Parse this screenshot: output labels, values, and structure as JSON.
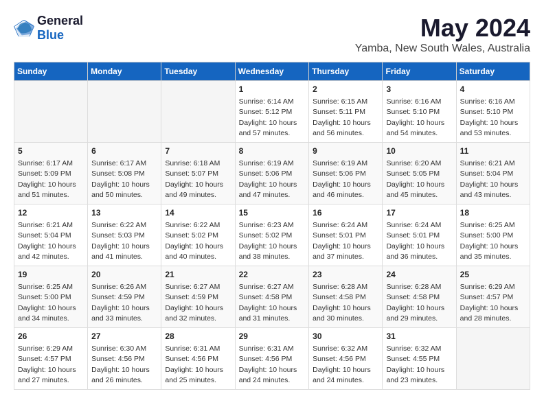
{
  "logo": {
    "general": "General",
    "blue": "Blue"
  },
  "title": "May 2024",
  "location": "Yamba, New South Wales, Australia",
  "days_of_week": [
    "Sunday",
    "Monday",
    "Tuesday",
    "Wednesday",
    "Thursday",
    "Friday",
    "Saturday"
  ],
  "weeks": [
    [
      {
        "day": "",
        "info": ""
      },
      {
        "day": "",
        "info": ""
      },
      {
        "day": "",
        "info": ""
      },
      {
        "day": "1",
        "info": "Sunrise: 6:14 AM\nSunset: 5:12 PM\nDaylight: 10 hours and 57 minutes."
      },
      {
        "day": "2",
        "info": "Sunrise: 6:15 AM\nSunset: 5:11 PM\nDaylight: 10 hours and 56 minutes."
      },
      {
        "day": "3",
        "info": "Sunrise: 6:16 AM\nSunset: 5:10 PM\nDaylight: 10 hours and 54 minutes."
      },
      {
        "day": "4",
        "info": "Sunrise: 6:16 AM\nSunset: 5:10 PM\nDaylight: 10 hours and 53 minutes."
      }
    ],
    [
      {
        "day": "5",
        "info": "Sunrise: 6:17 AM\nSunset: 5:09 PM\nDaylight: 10 hours and 51 minutes."
      },
      {
        "day": "6",
        "info": "Sunrise: 6:17 AM\nSunset: 5:08 PM\nDaylight: 10 hours and 50 minutes."
      },
      {
        "day": "7",
        "info": "Sunrise: 6:18 AM\nSunset: 5:07 PM\nDaylight: 10 hours and 49 minutes."
      },
      {
        "day": "8",
        "info": "Sunrise: 6:19 AM\nSunset: 5:06 PM\nDaylight: 10 hours and 47 minutes."
      },
      {
        "day": "9",
        "info": "Sunrise: 6:19 AM\nSunset: 5:06 PM\nDaylight: 10 hours and 46 minutes."
      },
      {
        "day": "10",
        "info": "Sunrise: 6:20 AM\nSunset: 5:05 PM\nDaylight: 10 hours and 45 minutes."
      },
      {
        "day": "11",
        "info": "Sunrise: 6:21 AM\nSunset: 5:04 PM\nDaylight: 10 hours and 43 minutes."
      }
    ],
    [
      {
        "day": "12",
        "info": "Sunrise: 6:21 AM\nSunset: 5:04 PM\nDaylight: 10 hours and 42 minutes."
      },
      {
        "day": "13",
        "info": "Sunrise: 6:22 AM\nSunset: 5:03 PM\nDaylight: 10 hours and 41 minutes."
      },
      {
        "day": "14",
        "info": "Sunrise: 6:22 AM\nSunset: 5:02 PM\nDaylight: 10 hours and 40 minutes."
      },
      {
        "day": "15",
        "info": "Sunrise: 6:23 AM\nSunset: 5:02 PM\nDaylight: 10 hours and 38 minutes."
      },
      {
        "day": "16",
        "info": "Sunrise: 6:24 AM\nSunset: 5:01 PM\nDaylight: 10 hours and 37 minutes."
      },
      {
        "day": "17",
        "info": "Sunrise: 6:24 AM\nSunset: 5:01 PM\nDaylight: 10 hours and 36 minutes."
      },
      {
        "day": "18",
        "info": "Sunrise: 6:25 AM\nSunset: 5:00 PM\nDaylight: 10 hours and 35 minutes."
      }
    ],
    [
      {
        "day": "19",
        "info": "Sunrise: 6:25 AM\nSunset: 5:00 PM\nDaylight: 10 hours and 34 minutes."
      },
      {
        "day": "20",
        "info": "Sunrise: 6:26 AM\nSunset: 4:59 PM\nDaylight: 10 hours and 33 minutes."
      },
      {
        "day": "21",
        "info": "Sunrise: 6:27 AM\nSunset: 4:59 PM\nDaylight: 10 hours and 32 minutes."
      },
      {
        "day": "22",
        "info": "Sunrise: 6:27 AM\nSunset: 4:58 PM\nDaylight: 10 hours and 31 minutes."
      },
      {
        "day": "23",
        "info": "Sunrise: 6:28 AM\nSunset: 4:58 PM\nDaylight: 10 hours and 30 minutes."
      },
      {
        "day": "24",
        "info": "Sunrise: 6:28 AM\nSunset: 4:58 PM\nDaylight: 10 hours and 29 minutes."
      },
      {
        "day": "25",
        "info": "Sunrise: 6:29 AM\nSunset: 4:57 PM\nDaylight: 10 hours and 28 minutes."
      }
    ],
    [
      {
        "day": "26",
        "info": "Sunrise: 6:29 AM\nSunset: 4:57 PM\nDaylight: 10 hours and 27 minutes."
      },
      {
        "day": "27",
        "info": "Sunrise: 6:30 AM\nSunset: 4:56 PM\nDaylight: 10 hours and 26 minutes."
      },
      {
        "day": "28",
        "info": "Sunrise: 6:31 AM\nSunset: 4:56 PM\nDaylight: 10 hours and 25 minutes."
      },
      {
        "day": "29",
        "info": "Sunrise: 6:31 AM\nSunset: 4:56 PM\nDaylight: 10 hours and 24 minutes."
      },
      {
        "day": "30",
        "info": "Sunrise: 6:32 AM\nSunset: 4:56 PM\nDaylight: 10 hours and 24 minutes."
      },
      {
        "day": "31",
        "info": "Sunrise: 6:32 AM\nSunset: 4:55 PM\nDaylight: 10 hours and 23 minutes."
      },
      {
        "day": "",
        "info": ""
      }
    ]
  ]
}
